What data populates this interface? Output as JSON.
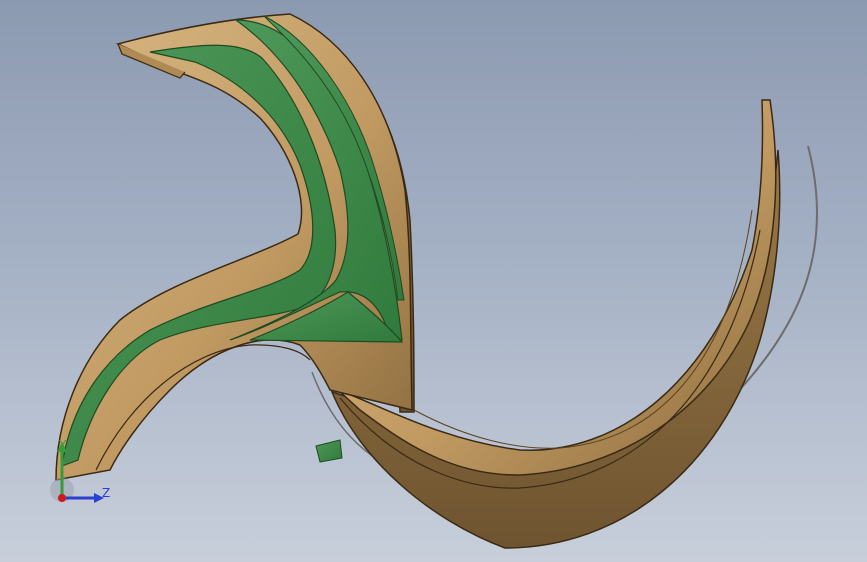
{
  "viewport": {
    "background_top": "#8c9ab1",
    "background_bottom": "#c8cfdb"
  },
  "model": {
    "body_color": "#c9a46c",
    "body_shadow_color": "#8a6a3c",
    "inset_color": "#3f8a4a",
    "outline_color": "#3a2a14"
  },
  "triad": {
    "y_label": "Y",
    "z_label": "Z",
    "y_color": "#3a9a3a",
    "z_color": "#2a3fd0",
    "origin_color": "#d01818"
  }
}
